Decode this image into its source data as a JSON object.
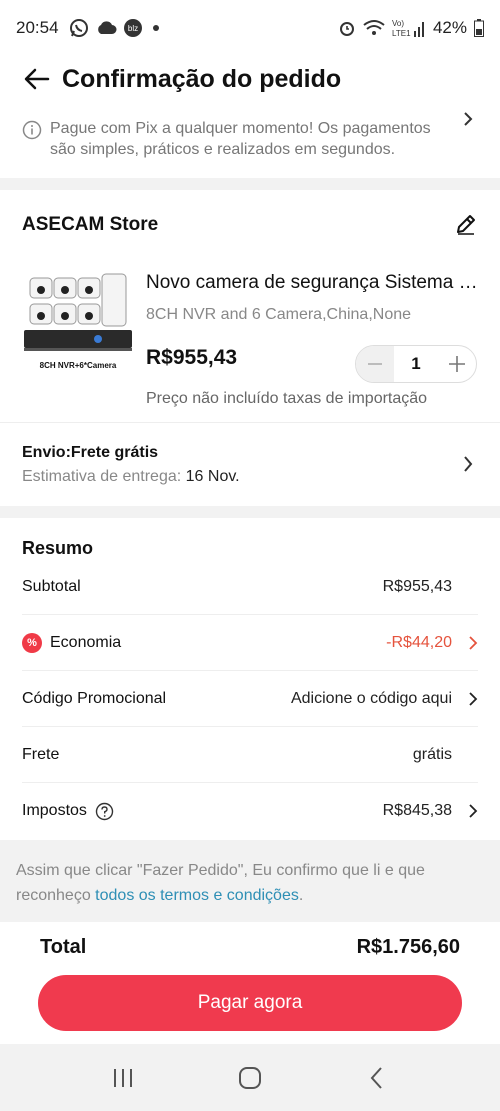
{
  "status_bar": {
    "time": "20:54",
    "battery": "42%",
    "signal_label": "Vo)\nLTE1",
    "blz_label": "blz"
  },
  "header": {
    "title": "Confirmação do pedido"
  },
  "pix": {
    "text": "Pague com Pix a qualquer momento! Os pagamentos são simples, práticos e realizados em segundos."
  },
  "store": {
    "name": "ASECAM Store",
    "product": {
      "title": "Novo camera de segurança Sistema de Vigilância",
      "variant": "8CH NVR and 6 Camera,China,None",
      "price": "R$955,43",
      "quantity": "1",
      "tax_note": "Preço não incluído taxas de importação",
      "image_caption": "8CH NVR+6*Camera"
    },
    "shipping": {
      "title": "Envio:Frete grátis",
      "estimate_label": "Estimativa de entrega: ",
      "estimate_date": "16 Nov."
    }
  },
  "summary": {
    "title": "Resumo",
    "rows": [
      {
        "label": "Subtotal",
        "value": "R$955,43"
      },
      {
        "label": "Economia",
        "value": "-R$44,20",
        "badge": "%"
      },
      {
        "label": "Código Promocional",
        "value": "Adicione o código aqui"
      },
      {
        "label": "Frete",
        "value": "grátis"
      },
      {
        "label": "Impostos",
        "value": "R$845,38"
      }
    ]
  },
  "terms": {
    "text": "Assim que clicar \"Fazer Pedido\", Eu confirmo que li e que reconheço ",
    "link": "todos os termos e condições",
    "end": "."
  },
  "checkout": {
    "total_label": "Total",
    "total_value": "R$1.756,60",
    "pay_button": "Pagar agora"
  },
  "colors": {
    "accent": "#f03a4e",
    "discount": "#e5533d",
    "link": "#2e8fb5"
  },
  "icons": [
    "whatsapp-icon",
    "cloud-icon",
    "blz-icon",
    "dot-icon",
    "alarm-icon",
    "wifi-icon",
    "signal-icon",
    "battery-icon",
    "back-arrow-icon",
    "info-icon",
    "chevron-right-icon",
    "edit-pencil-icon",
    "percent-badge-icon",
    "help-icon",
    "recent-apps-icon",
    "home-icon",
    "back-icon"
  ]
}
